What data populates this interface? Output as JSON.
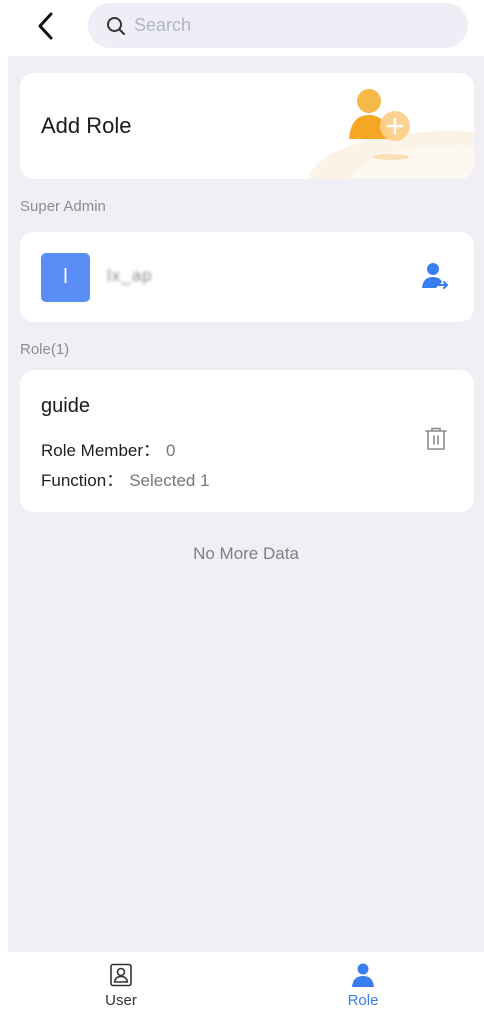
{
  "header": {
    "back_icon": "chevron-left-icon",
    "search_icon": "search-icon",
    "search_placeholder": "Search",
    "search_value": ""
  },
  "add_role": {
    "title": "Add Role",
    "illustration": "add-user-illustration"
  },
  "super_admin": {
    "section_label": "Super Admin",
    "avatar_initial": "l",
    "name": "lx_ap",
    "action_icon": "transfer-user-icon"
  },
  "roles": {
    "section_label": "Role(1)",
    "items": [
      {
        "name": "guide",
        "member_label": "Role Member：",
        "member_value": "0",
        "function_label": "Function：",
        "function_value": "Selected 1",
        "delete_icon": "trash-icon"
      }
    ]
  },
  "footer_text": "No More Data",
  "tabbar": {
    "tabs": [
      {
        "label": "User",
        "icon": "user-card-icon",
        "active": false
      },
      {
        "label": "Role",
        "icon": "person-icon",
        "active": true
      }
    ]
  },
  "colors": {
    "accent": "#3a7df0",
    "avatar": "#5b8ef4",
    "background": "#efeff5",
    "illustration": "#f5a623"
  }
}
